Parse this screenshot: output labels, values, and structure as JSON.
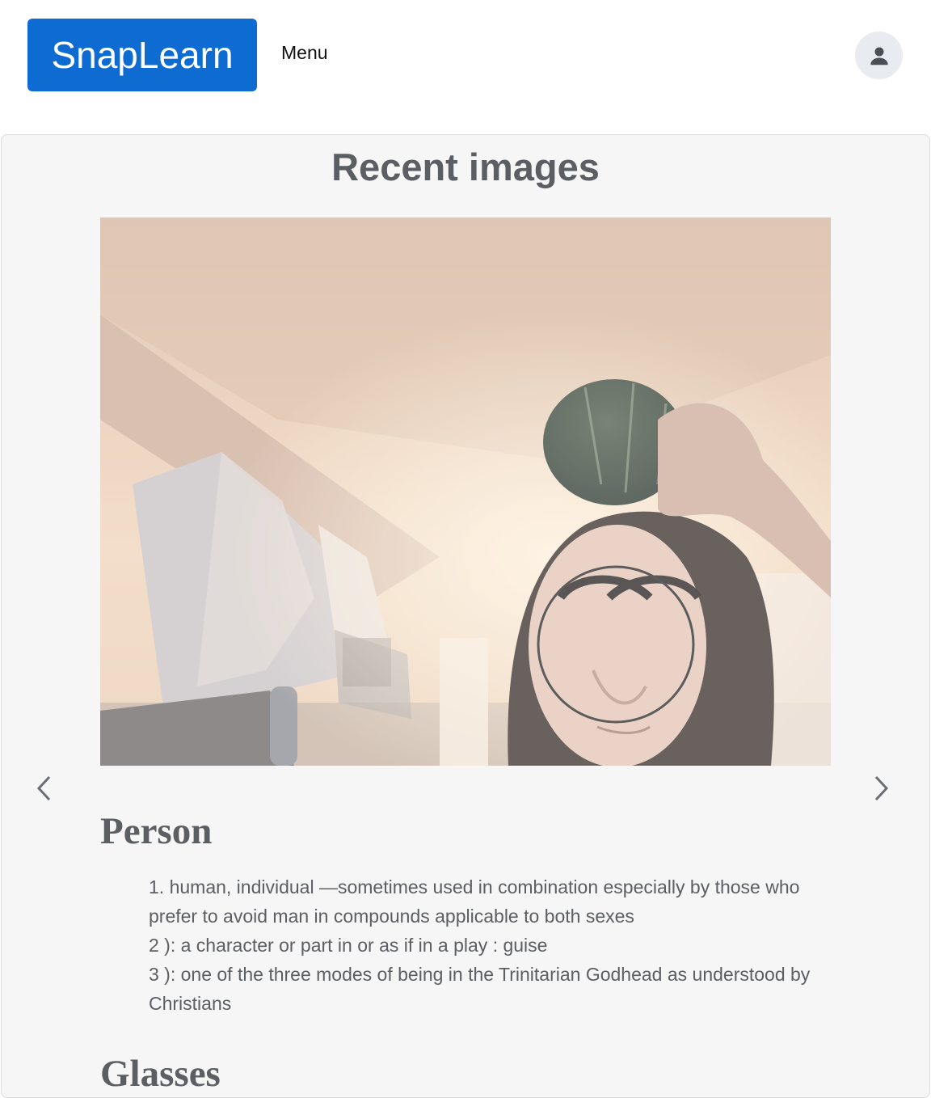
{
  "header": {
    "brand": "SnapLearn",
    "menu_label": "Menu",
    "avatar_icon": "user-icon"
  },
  "recent": {
    "title": "Recent images",
    "prev_icon": "chevron-left-icon",
    "next_icon": "chevron-right-icon"
  },
  "entries": [
    {
      "term": "Person",
      "definitions": [
        "1. human, individual —sometimes used in combination especially by those who prefer to avoid man in compounds applicable to both sexes",
        "2 ): a character or part in or as if in a play : guise",
        "3 ): one of the three modes of being in the Trinitarian Godhead as understood by Christians"
      ]
    },
    {
      "term": "Glasses"
    }
  ],
  "colors": {
    "brand": "#0d6bd1",
    "panel_bg": "#f6f6f6",
    "text_muted": "#5b5e62"
  }
}
